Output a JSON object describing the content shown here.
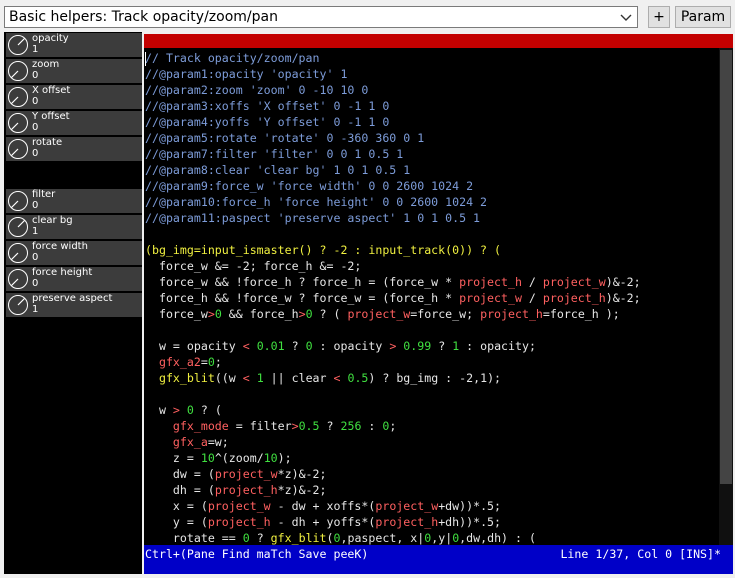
{
  "header": {
    "preset_value": "Basic helpers: Track opacity/zoom/pan",
    "add_label": "+",
    "param_label": "Param"
  },
  "knobs_group1": [
    {
      "label": "opacity",
      "value": "1"
    },
    {
      "label": "zoom",
      "value": "0"
    },
    {
      "label": "X offset",
      "value": "0"
    },
    {
      "label": "Y offset",
      "value": "0"
    },
    {
      "label": "rotate",
      "value": "0"
    }
  ],
  "knobs_group2": [
    {
      "label": "filter",
      "value": "0"
    },
    {
      "label": "clear bg",
      "value": "1"
    },
    {
      "label": "force width",
      "value": "0"
    },
    {
      "label": "force height",
      "value": "0"
    },
    {
      "label": "preserve aspect",
      "value": "1"
    }
  ],
  "code_lines": [
    [
      [
        "c-comment",
        "// Track opacity/zoom/pan"
      ]
    ],
    [
      [
        "c-comment",
        "//@param1:opacity 'opacity' 1"
      ]
    ],
    [
      [
        "c-comment",
        "//@param2:zoom 'zoom' 0 -10 10 0"
      ]
    ],
    [
      [
        "c-comment",
        "//@param3:xoffs 'X offset' 0 -1 1 0"
      ]
    ],
    [
      [
        "c-comment",
        "//@param4:yoffs 'Y offset' 0 -1 1 0"
      ]
    ],
    [
      [
        "c-comment",
        "//@param5:rotate 'rotate' 0 -360 360 0 1"
      ]
    ],
    [
      [
        "c-comment",
        "//@param7:filter 'filter' 0 0 1 0.5 1"
      ]
    ],
    [
      [
        "c-comment",
        "//@param8:clear 'clear bg' 1 0 1 0.5 1"
      ]
    ],
    [
      [
        "c-comment",
        "//@param9:force_w 'force width' 0 0 2600 1024 2"
      ]
    ],
    [
      [
        "c-comment",
        "//@param10:force_h 'force height' 0 0 2600 1024 2"
      ]
    ],
    [
      [
        "c-comment",
        "//@param11:paspect 'preserve aspect' 1 0 1 0.5 1"
      ]
    ],
    [],
    [
      [
        "c-func",
        "(bg_img=input_ismaster() ? -2 : input_track(0)) ? ("
      ]
    ],
    [
      [
        "c-text",
        "  force_w &= -2; force_h &= -2;"
      ]
    ],
    [
      [
        "c-text",
        "  force_w && !force_h ? force_h = (force_w * "
      ],
      [
        "c-var",
        "project_h"
      ],
      [
        "c-text",
        " / "
      ],
      [
        "c-var",
        "project_w"
      ],
      [
        "c-text",
        ")&-2;"
      ]
    ],
    [
      [
        "c-text",
        "  force_h && !force_w ? force_w = (force_h * "
      ],
      [
        "c-var",
        "project_w"
      ],
      [
        "c-text",
        " / "
      ],
      [
        "c-var",
        "project_h"
      ],
      [
        "c-text",
        ")&-2;"
      ]
    ],
    [
      [
        "c-text",
        "  force_w"
      ],
      [
        "c-op",
        ">"
      ],
      [
        "c-num",
        "0"
      ],
      [
        "c-text",
        " && force_h"
      ],
      [
        "c-op",
        ">"
      ],
      [
        "c-num",
        "0"
      ],
      [
        "c-text",
        " ? ( "
      ],
      [
        "c-var",
        "project_w"
      ],
      [
        "c-text",
        "=force_w; "
      ],
      [
        "c-var",
        "project_h"
      ],
      [
        "c-text",
        "=force_h );"
      ]
    ],
    [],
    [
      [
        "c-text",
        "  w = opacity "
      ],
      [
        "c-op",
        "<"
      ],
      [
        "c-num",
        " 0.01"
      ],
      [
        "c-text",
        " ? "
      ],
      [
        "c-num",
        "0"
      ],
      [
        "c-text",
        " : opacity "
      ],
      [
        "c-op",
        ">"
      ],
      [
        "c-num",
        " 0.99"
      ],
      [
        "c-text",
        " ? "
      ],
      [
        "c-num",
        "1"
      ],
      [
        "c-text",
        " : opacity;"
      ]
    ],
    [
      [
        "c-var",
        "  gfx_a2"
      ],
      [
        "c-text",
        "="
      ],
      [
        "c-num",
        "0"
      ],
      [
        "c-text",
        ";"
      ]
    ],
    [
      [
        "c-func",
        "  gfx_blit"
      ],
      [
        "c-text",
        "((w "
      ],
      [
        "c-op",
        "<"
      ],
      [
        "c-num",
        " 1"
      ],
      [
        "c-text",
        " || clear "
      ],
      [
        "c-op",
        "<"
      ],
      [
        "c-num",
        " 0.5"
      ],
      [
        "c-text",
        ") ? bg_img : -2,1);"
      ]
    ],
    [],
    [
      [
        "c-text",
        "  w "
      ],
      [
        "c-op",
        ">"
      ],
      [
        "c-num",
        " 0"
      ],
      [
        "c-text",
        " ? ("
      ]
    ],
    [
      [
        "c-var",
        "    gfx_mode"
      ],
      [
        "c-text",
        " = filter"
      ],
      [
        "c-op",
        ">"
      ],
      [
        "c-num",
        "0.5"
      ],
      [
        "c-text",
        " ? "
      ],
      [
        "c-num",
        "256"
      ],
      [
        "c-text",
        " : "
      ],
      [
        "c-num",
        "0"
      ],
      [
        "c-text",
        ";"
      ]
    ],
    [
      [
        "c-var",
        "    gfx_a"
      ],
      [
        "c-text",
        "=w;"
      ]
    ],
    [
      [
        "c-text",
        "    z = "
      ],
      [
        "c-num",
        "10"
      ],
      [
        "c-text",
        "^(zoom/"
      ],
      [
        "c-num",
        "10"
      ],
      [
        "c-text",
        ");"
      ]
    ],
    [
      [
        "c-text",
        "    dw = ("
      ],
      [
        "c-var",
        "project_w"
      ],
      [
        "c-text",
        "*z)&-2;"
      ]
    ],
    [
      [
        "c-text",
        "    dh = ("
      ],
      [
        "c-var",
        "project_h"
      ],
      [
        "c-text",
        "*z)&-2;"
      ]
    ],
    [
      [
        "c-text",
        "    x = ("
      ],
      [
        "c-var",
        "project_w"
      ],
      [
        "c-text",
        " - dw + xoffs*("
      ],
      [
        "c-var",
        "project_w"
      ],
      [
        "c-text",
        "+dw))*.5;"
      ]
    ],
    [
      [
        "c-text",
        "    y = ("
      ],
      [
        "c-var",
        "project_h"
      ],
      [
        "c-text",
        " - dh + yoffs*("
      ],
      [
        "c-var",
        "project_h"
      ],
      [
        "c-text",
        "+dh))*.5;"
      ]
    ],
    [
      [
        "c-text",
        "    rotate == "
      ],
      [
        "c-num",
        "0"
      ],
      [
        "c-text",
        " ? "
      ],
      [
        "c-func",
        "gfx_blit"
      ],
      [
        "c-text",
        "("
      ],
      [
        "c-num",
        "0"
      ],
      [
        "c-text",
        ",paspect, x|"
      ],
      [
        "c-num",
        "0"
      ],
      [
        "c-text",
        ",y|"
      ],
      [
        "c-num",
        "0"
      ],
      [
        "c-text",
        ",dw,dh) : ("
      ]
    ]
  ],
  "status": {
    "left": "Ctrl+(Pane Find maTch Save peeK)",
    "right": "Line 1/37, Col 0 [INS]*"
  }
}
